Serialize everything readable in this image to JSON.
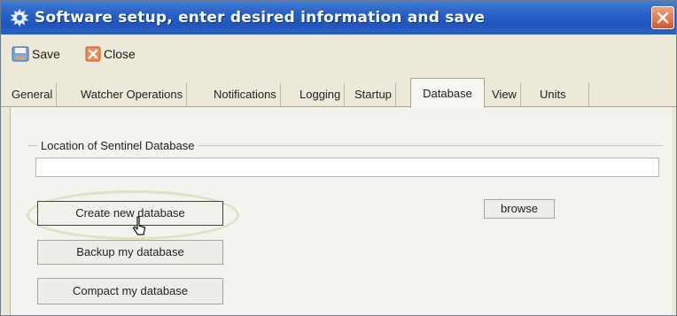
{
  "window": {
    "title": "Software setup, enter desired information and save",
    "title_icon": "gear-icon",
    "close_icon": "close-icon"
  },
  "toolbar": {
    "save_label": "Save",
    "save_icon": "save-icon",
    "close_label": "Close",
    "close_icon": "close-icon"
  },
  "tabs": [
    {
      "label": "General"
    },
    {
      "label": "Watcher Operations"
    },
    {
      "label": "Notifications"
    },
    {
      "label": "Logging"
    },
    {
      "label": "Startup"
    },
    {
      "label": "Database",
      "active": true
    },
    {
      "label": "View"
    },
    {
      "label": "Units"
    }
  ],
  "database": {
    "group_label": "Location of Sentinel Database",
    "location_value": "",
    "browse_label": "browse",
    "create_label": "Create new database",
    "backup_label": "Backup my database",
    "compact_label": "Compact my database",
    "pointer_icon": "mouse-pointer-icon"
  }
}
